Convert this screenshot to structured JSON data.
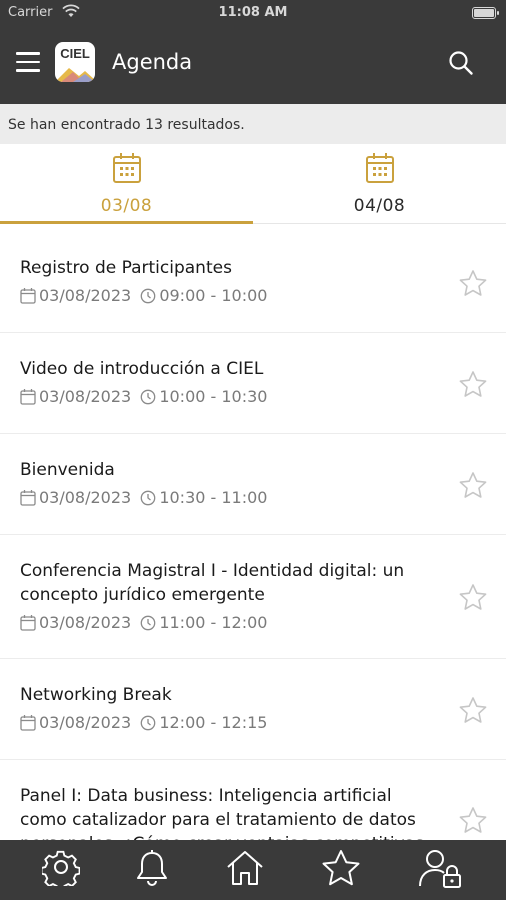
{
  "status_bar": {
    "carrier": "Carrier",
    "time": "11:08 AM"
  },
  "header": {
    "logo_text": "CIEL",
    "title": "Agenda",
    "menu_icon": "hamburger-menu-icon",
    "search_icon": "search-icon"
  },
  "results_text": "Se han encontrado 13 resultados.",
  "accent_color": "#caa13d",
  "header_color": "#3a3a3a",
  "date_tabs": [
    {
      "label": "03/08",
      "active": true
    },
    {
      "label": "04/08",
      "active": false
    }
  ],
  "sessions": [
    {
      "title": "Registro de Participantes",
      "date": "03/08/2023",
      "time": "09:00 - 10:00"
    },
    {
      "title": "Video de introducción a CIEL",
      "date": "03/08/2023",
      "time": "10:00 - 10:30"
    },
    {
      "title": "Bienvenida",
      "date": "03/08/2023",
      "time": "10:30 - 11:00"
    },
    {
      "title": "Conferencia Magistral I - Identidad digital: un concepto jurídico emergente",
      "date": "03/08/2023",
      "time": "11:00 - 12:00"
    },
    {
      "title": "Networking Break",
      "date": "03/08/2023",
      "time": "12:00 - 12:15"
    },
    {
      "title": "Panel I: Data business: Inteligencia artificial como catalizador para el tratamiento de datos personales. ¿Cómo crear ventajas competitivas en",
      "date": "",
      "time": ""
    }
  ],
  "bottom_tabs": [
    "settings-gear-icon",
    "notifications-bell-icon",
    "home-icon",
    "favorites-star-icon",
    "user-lock-icon"
  ]
}
